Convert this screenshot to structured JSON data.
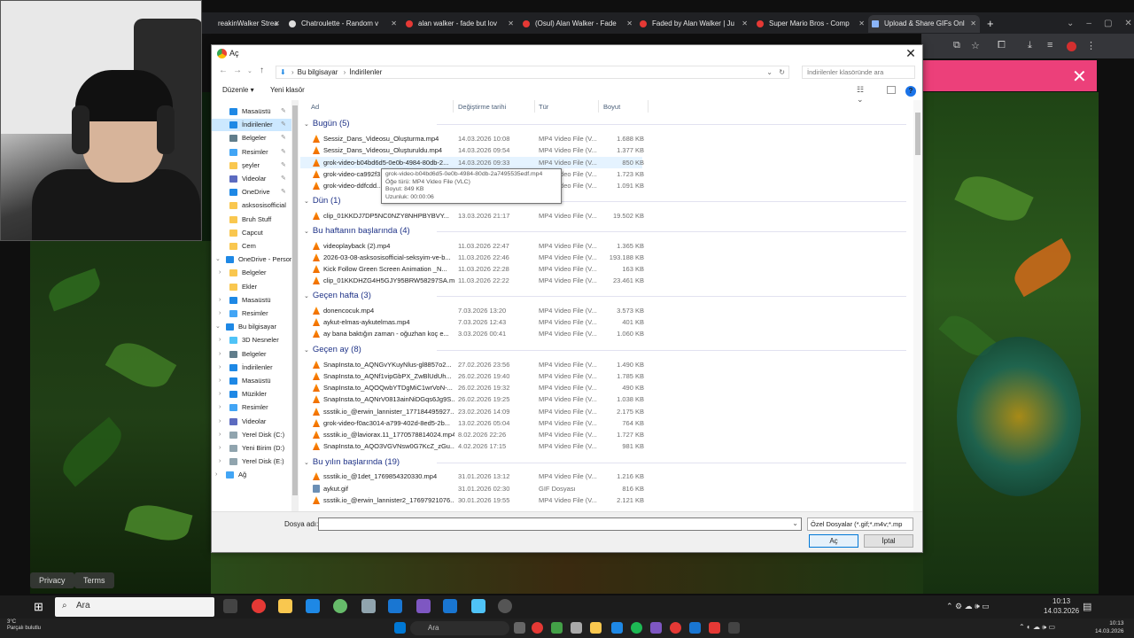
{
  "browser": {
    "tabs": [
      {
        "label": "reakinWalker Strea",
        "active": false
      },
      {
        "label": "Chatroulette - Random v",
        "active": false
      },
      {
        "label": "alan walker - fade but lov",
        "active": false
      },
      {
        "label": "(Osul) Alan Walker - Fade",
        "active": false
      },
      {
        "label": "Faded by Alan Walker | Ju",
        "active": false
      },
      {
        "label": "Super Mario Bros - Comp",
        "active": false
      },
      {
        "label": "Upload & Share GIFs Onl",
        "active": true
      }
    ],
    "new_tab": "+",
    "bottom_links": [
      "Privacy",
      "Terms"
    ]
  },
  "dialog": {
    "title": "Aç",
    "close": "✕",
    "breadcrumb": [
      "Bu bilgisayar",
      "İndirilenler"
    ],
    "search_placeholder": "İndirilenler klasöründe ara",
    "toolbar": {
      "organize": "Düzenle ▾",
      "new_folder": "Yeni klasör",
      "help": "?"
    },
    "nav_items": [
      {
        "label": "Masaüstü",
        "color": "#1e88e5",
        "pinned": true,
        "indent": 0
      },
      {
        "label": "İndirilenler",
        "color": "#1e88e5",
        "pinned": true,
        "indent": 0,
        "selected": true
      },
      {
        "label": "Belgeler",
        "color": "#607d8b",
        "pinned": true,
        "indent": 0
      },
      {
        "label": "Resimler",
        "color": "#42a5f5",
        "pinned": true,
        "indent": 0
      },
      {
        "label": "şeyler",
        "color": "#f9c74f",
        "pinned": true,
        "indent": 0
      },
      {
        "label": "Videolar",
        "color": "#5c6bc0",
        "pinned": true,
        "indent": 0
      },
      {
        "label": "OneDrive",
        "color": "#1e88e5",
        "pinned": true,
        "indent": 0
      },
      {
        "label": "asksosisofficial",
        "color": "#f9c74f",
        "indent": 0
      },
      {
        "label": "Bruh Stuff",
        "color": "#f9c74f",
        "indent": 0
      },
      {
        "label": "Capcut",
        "color": "#f9c74f",
        "indent": 0
      },
      {
        "label": "Cem",
        "color": "#f9c74f",
        "indent": 0
      },
      {
        "label": "OneDrive - Persor",
        "color": "#1e88e5",
        "indent": -1,
        "expand": "⌄"
      },
      {
        "label": "Belgeler",
        "color": "#f9c74f",
        "indent": 1,
        "expand": "›"
      },
      {
        "label": "Ekler",
        "color": "#f9c74f",
        "indent": 1
      },
      {
        "label": "Masaüstü",
        "color": "#1e88e5",
        "indent": 1,
        "expand": "›"
      },
      {
        "label": "Resimler",
        "color": "#42a5f5",
        "indent": 1,
        "expand": "›"
      },
      {
        "label": "Bu bilgisayar",
        "color": "#1e88e5",
        "indent": -1,
        "expand": "⌄"
      },
      {
        "label": "3D Nesneler",
        "color": "#4fc3f7",
        "indent": 1,
        "expand": "›"
      },
      {
        "label": "Belgeler",
        "color": "#607d8b",
        "indent": 1,
        "expand": "›"
      },
      {
        "label": "İndirilenler",
        "color": "#1e88e5",
        "indent": 1,
        "expand": "›"
      },
      {
        "label": "Masaüstü",
        "color": "#1e88e5",
        "indent": 1,
        "expand": "›"
      },
      {
        "label": "Müzikler",
        "color": "#1e88e5",
        "indent": 1,
        "expand": "›"
      },
      {
        "label": "Resimler",
        "color": "#42a5f5",
        "indent": 1,
        "expand": "›"
      },
      {
        "label": "Videolar",
        "color": "#5c6bc0",
        "indent": 1,
        "expand": "›"
      },
      {
        "label": "Yerel Disk (C:)",
        "color": "#90a4ae",
        "indent": 1,
        "expand": "›"
      },
      {
        "label": "Yeni Birim (D:)",
        "color": "#90a4ae",
        "indent": 1,
        "expand": "›"
      },
      {
        "label": "Yerel Disk (E:)",
        "color": "#90a4ae",
        "indent": 1,
        "expand": "›"
      },
      {
        "label": "Ağ",
        "color": "#42a5f5",
        "indent": -1,
        "expand": "›"
      }
    ],
    "columns": [
      "Ad",
      "Değiştirme tarihi",
      "Tür",
      "Boyut"
    ],
    "groups": [
      {
        "label": "Bugün (5)",
        "rows": [
          {
            "name": "Sessiz_Dans_Videosu_Oluşturma.mp4",
            "date": "14.03.2026 10:08",
            "type": "MP4 Video File (V...",
            "size": "1.688 KB"
          },
          {
            "name": "Sessiz_Dans_Videosu_Oluşturuldu.mp4",
            "date": "14.03.2026 09:54",
            "type": "MP4 Video File (V...",
            "size": "1.377 KB"
          },
          {
            "name": "grok-video-b04bd6d5-0e0b-4984-80db-2...",
            "date": "14.03.2026 09:33",
            "type": "MP4 Video File (V...",
            "size": "850 KB",
            "hover": true
          },
          {
            "name": "grok-video-ca992f3...",
            "date": "",
            "type": "MP4 Video File (V...",
            "size": "1.723 KB"
          },
          {
            "name": "grok-video-ddfcdd...",
            "date": "",
            "type": "MP4 Video File (V...",
            "size": "1.091 KB"
          }
        ]
      },
      {
        "label": "Dün (1)",
        "rows": [
          {
            "name": "clip_01KKDJ7DP5NC0NZY8NHPBYBVY...",
            "date": "13.03.2026 21:17",
            "type": "MP4 Video File (V...",
            "size": "19.502 KB"
          }
        ]
      },
      {
        "label": "Bu haftanın başlarında (4)",
        "rows": [
          {
            "name": "videoplayback (2).mp4",
            "date": "11.03.2026 22:47",
            "type": "MP4 Video File (V...",
            "size": "1.365 KB"
          },
          {
            "name": "2026-03-08-asksosisofficial-seksyim-ve-b...",
            "date": "11.03.2026 22:46",
            "type": "MP4 Video File (V...",
            "size": "193.188 KB"
          },
          {
            "name": "Kick Follow Green Screen Animation _N...",
            "date": "11.03.2026 22:28",
            "type": "MP4 Video File (V...",
            "size": "163 KB"
          },
          {
            "name": "clip_01KKDHZG4H5GJY95BRW58297SA.m...",
            "date": "11.03.2026 22:22",
            "type": "MP4 Video File (V...",
            "size": "23.461 KB"
          }
        ]
      },
      {
        "label": "Geçen hafta (3)",
        "rows": [
          {
            "name": "donencocuk.mp4",
            "date": "7.03.2026 13:20",
            "type": "MP4 Video File (V...",
            "size": "3.573 KB"
          },
          {
            "name": "aykut-elmas-aykutelmas.mp4",
            "date": "7.03.2026 12:43",
            "type": "MP4 Video File (V...",
            "size": "401 KB"
          },
          {
            "name": "ay bana baktığın zaman - oğuzhan koç e...",
            "date": "3.03.2026 00:41",
            "type": "MP4 Video File (V...",
            "size": "1.060 KB"
          }
        ]
      },
      {
        "label": "Geçen ay (8)",
        "rows": [
          {
            "name": "SnapInsta.to_AQNGvYKuyNlus-gl8857o2...",
            "date": "27.02.2026 23:56",
            "type": "MP4 Video File (V...",
            "size": "1.490 KB"
          },
          {
            "name": "SnapInsta.to_AQNf1vipGbPX_ZwBlUdUh...",
            "date": "26.02.2026 19:40",
            "type": "MP4 Video File (V...",
            "size": "1.785 KB"
          },
          {
            "name": "SnapInsta.to_AQOQwbYTDgMiC1wrVoN-...",
            "date": "26.02.2026 19:32",
            "type": "MP4 Video File (V...",
            "size": "490 KB"
          },
          {
            "name": "SnapInsta.to_AQNrV0813ainNiDGqs6Jg9S...",
            "date": "26.02.2026 19:25",
            "type": "MP4 Video File (V...",
            "size": "1.038 KB"
          },
          {
            "name": "ssstik.io_@erwin_lannister_177184495927...",
            "date": "23.02.2026 14:09",
            "type": "MP4 Video File (V...",
            "size": "2.175 KB"
          },
          {
            "name": "grok-video-f0ac3014-a799-402d-8ed5-2b...",
            "date": "13.02.2026 05:04",
            "type": "MP4 Video File (V...",
            "size": "764 KB"
          },
          {
            "name": "ssstik.io_@laviorax.11_1770578814024.mp4",
            "date": "8.02.2026 22:26",
            "type": "MP4 Video File (V...",
            "size": "1.727 KB"
          },
          {
            "name": "SnapInsta.to_AQO3VGVNsw0G7KcZ_zGu...",
            "date": "4.02.2026 17:15",
            "type": "MP4 Video File (V...",
            "size": "981 KB"
          }
        ]
      },
      {
        "label": "Bu yılın başlarında (19)",
        "rows": [
          {
            "name": "ssstik.io_@1det_1769854320330.mp4",
            "date": "31.01.2026 13:12",
            "type": "MP4 Video File (V...",
            "size": "1.216 KB"
          },
          {
            "name": "aykut.gif",
            "date": "31.01.2026 02:30",
            "type": "GIF Dosyası",
            "size": "816 KB",
            "gif": true
          },
          {
            "name": "ssstik.io_@erwin_lannister2_17697921076...",
            "date": "30.01.2026 19:55",
            "type": "MP4 Video File (V...",
            "size": "2.121 KB"
          }
        ]
      }
    ],
    "tooltip": {
      "line1": "grok-video-b04bd6d5-0e0b-4984-80db-2a7495535edf.mp4",
      "line2": "Öğe türü: MP4 Video File (VLC)",
      "line3": "Boyut: 849 KB",
      "line4": "Uzunluk: 00:00:06"
    },
    "footer": {
      "filename_label": "Dosya adı:",
      "filename_value": "",
      "filter": "Özel Dosyalar (*.gif;*.m4v;*.mp",
      "open": "Aç",
      "cancel": "İptal"
    }
  },
  "taskbar": {
    "search_label": "Ara",
    "clock_time": "10:13",
    "clock_date": "14.03.2026",
    "weather_temp": "3°C",
    "weather_desc": "Parçalı bulutlu",
    "search2_label": "Ara",
    "clock2_time": "10:13",
    "clock2_date": "14.03.2026"
  }
}
